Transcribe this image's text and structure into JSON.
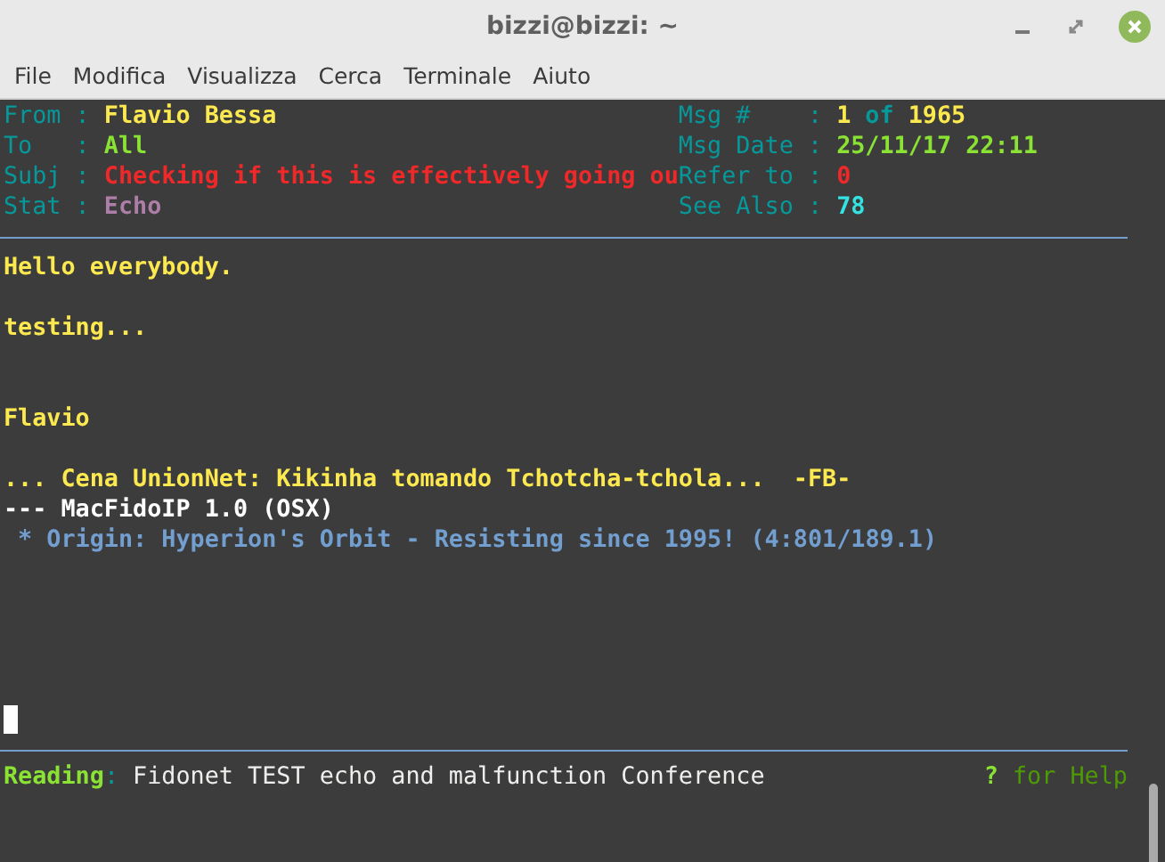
{
  "window": {
    "title": "bizzi@bizzi: ~"
  },
  "menu": [
    "File",
    "Modifica",
    "Visualizza",
    "Cerca",
    "Terminale",
    "Aiuto"
  ],
  "header": {
    "left": [
      {
        "label": "From",
        "separator": ":",
        "parts": [
          {
            "text": "Flavio Bessa",
            "color": "#fce94f"
          }
        ]
      },
      {
        "label": "To",
        "separator": ":",
        "parts": [
          {
            "text": "All",
            "color": "#8ae234"
          }
        ]
      },
      {
        "label": "Subj",
        "separator": ":",
        "parts": [
          {
            "text": "Checking if this is effectively going ou",
            "color": "#ef2929"
          }
        ]
      },
      {
        "label": "Stat",
        "separator": ":",
        "parts": [
          {
            "text": "Echo",
            "color": "#ad7fa8"
          }
        ]
      }
    ],
    "right": [
      {
        "label": "Msg #",
        "separator": ":",
        "parts": [
          {
            "text": "1",
            "color": "#fce94f"
          },
          {
            "text": "of",
            "color": "#06989a"
          },
          {
            "text": "1965",
            "color": "#fce94f"
          }
        ]
      },
      {
        "label": "Msg Date",
        "separator": ":",
        "parts": [
          {
            "text": "25/11/17 22:11",
            "color": "#8ae234"
          }
        ]
      },
      {
        "label": "Refer to",
        "separator": ":",
        "parts": [
          {
            "text": "0",
            "color": "#ef2929"
          }
        ]
      },
      {
        "label": "See Also",
        "separator": ":",
        "parts": [
          {
            "text": "78",
            "color": "#34e2e2"
          }
        ]
      }
    ]
  },
  "body": [
    {
      "kind": "text",
      "text": "Hello everybody."
    },
    {
      "kind": "blank"
    },
    {
      "kind": "text",
      "text": "testing..."
    },
    {
      "kind": "blank"
    },
    {
      "kind": "blank"
    },
    {
      "kind": "text",
      "text": "Flavio"
    },
    {
      "kind": "blank"
    },
    {
      "kind": "text",
      "text": "... Cena UnionNet: Kikinha tomando Tchotcha-tchola...  -FB-"
    },
    {
      "kind": "tearline",
      "text": "--- MacFidoIP 1.0 (OSX)"
    },
    {
      "kind": "origin",
      "text": " * Origin: Hyperion's Orbit - Resisting since 1995! (4:801/189.1)"
    }
  ],
  "status": {
    "label": "Reading",
    "separator": ":",
    "area": "Fidonet TEST echo and malfunction Conference",
    "help_key": "?",
    "help_text": "for Help"
  }
}
